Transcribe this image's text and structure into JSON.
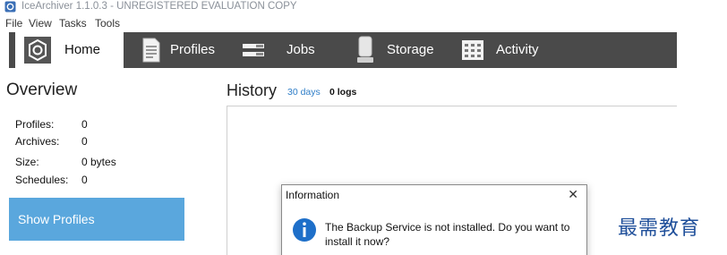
{
  "window": {
    "title": "IceArchiver 1.1.0.3 - UNREGISTERED EVALUATION COPY",
    "app_icon": "icearchiver-app-icon"
  },
  "menu": {
    "items": [
      {
        "label": "File"
      },
      {
        "label": "View"
      },
      {
        "label": "Tasks"
      },
      {
        "label": "Tools"
      }
    ]
  },
  "nav": {
    "items": [
      {
        "label": "Home",
        "icon": "home-icon",
        "active": true
      },
      {
        "label": "Profiles",
        "icon": "profiles-document-icon",
        "active": false
      },
      {
        "label": "Jobs",
        "icon": "jobs-list-icon",
        "active": false
      },
      {
        "label": "Storage",
        "icon": "storage-drive-icon",
        "active": false
      },
      {
        "label": "Activity",
        "icon": "activity-grid-icon",
        "active": false
      }
    ],
    "background": "#4a4a4a"
  },
  "overview": {
    "title": "Overview",
    "stats": [
      {
        "label": "Profiles:",
        "value": "0"
      },
      {
        "label": "Archives:",
        "value": "0"
      },
      {
        "label": "Size:",
        "value": "0 bytes"
      },
      {
        "label": "Schedules:",
        "value": "0"
      }
    ],
    "show_profiles_label": "Show Profiles",
    "button_color": "#5aa7dd"
  },
  "history": {
    "title": "History",
    "range_link": "30 days",
    "logs_count": "0 logs"
  },
  "dialog": {
    "title": "Information",
    "close_glyph": "✕",
    "icon": "info-icon",
    "message": "The Backup Service is not installed. Do you want to install it now?"
  },
  "watermark": {
    "text": "最需教育"
  }
}
